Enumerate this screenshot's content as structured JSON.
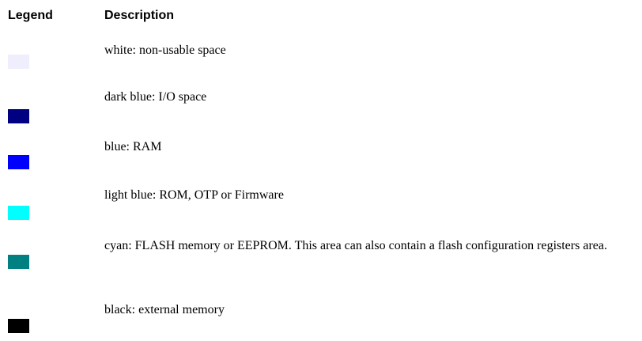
{
  "headers": {
    "legend": "Legend",
    "description": "Description"
  },
  "rows": [
    {
      "swatch_color": "#eeeefd",
      "description": "white: non-usable space"
    },
    {
      "swatch_color": "#000080",
      "description": "dark blue: I/O space"
    },
    {
      "swatch_color": "#0000ff",
      "description": "blue: RAM"
    },
    {
      "swatch_color": "#00ffff",
      "description": "light blue: ROM, OTP or Firmware"
    },
    {
      "swatch_color": "#008080",
      "description": "cyan: FLASH memory or EEPROM. This area can also contain a flash configuration registers area."
    },
    {
      "swatch_color": "#000000",
      "description": "black: external memory"
    }
  ]
}
